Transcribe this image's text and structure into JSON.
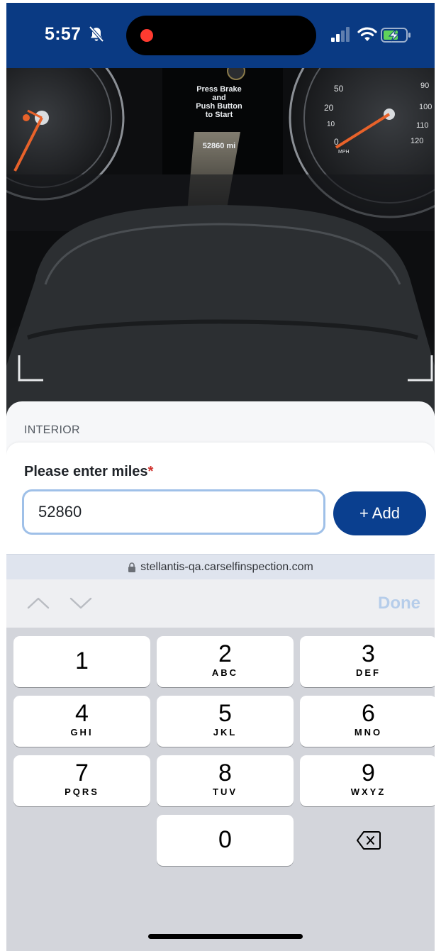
{
  "status_bar": {
    "time": "5:57",
    "colors": {
      "background": "#0a3a83",
      "recording_dot": "#ff3b30"
    }
  },
  "camera": {
    "cluster_message": [
      "Press Brake",
      "and",
      "Push Button",
      "to Start"
    ],
    "odometer_display": "52860 mi",
    "speedo_ticks": [
      "50",
      "20",
      "10",
      "0",
      "90",
      "100",
      "110",
      "120",
      "MPH"
    ]
  },
  "form": {
    "section": "INTERIOR",
    "label": "Please enter miles",
    "required_mark": "*",
    "miles_value": "52860",
    "add_button": "+ Add",
    "colors": {
      "accent": "#0a3f8f",
      "input_border": "#9fc0e8",
      "required": "#d0312d"
    }
  },
  "browser": {
    "url": "stellantis-qa.carselfinspection.com"
  },
  "keyboard_toolbar": {
    "done": "Done"
  },
  "keypad": {
    "keys": [
      {
        "num": "1",
        "letters": ""
      },
      {
        "num": "2",
        "letters": "ABC"
      },
      {
        "num": "3",
        "letters": "DEF"
      },
      {
        "num": "4",
        "letters": "GHI"
      },
      {
        "num": "5",
        "letters": "JKL"
      },
      {
        "num": "6",
        "letters": "MNO"
      },
      {
        "num": "7",
        "letters": "PQRS"
      },
      {
        "num": "8",
        "letters": "TUV"
      },
      {
        "num": "9",
        "letters": "WXYZ"
      },
      {
        "num": "0",
        "letters": ""
      }
    ]
  }
}
